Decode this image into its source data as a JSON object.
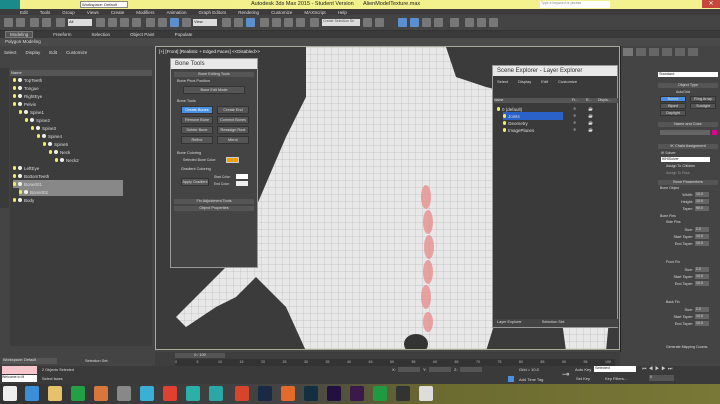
{
  "title": {
    "workspace": "Workspace: Default",
    "app": "Autodesk 3ds Max  2015  - Student Version",
    "file": "AlienModelTexture.max",
    "search_placeholder": "Type a keyword or phrase"
  },
  "menu": [
    "Edit",
    "Tools",
    "Group",
    "Views",
    "Create",
    "Modifiers",
    "Animation",
    "Graph Editors",
    "Rendering",
    "Customize",
    "MAXScript",
    "Help"
  ],
  "toolbar": {
    "filter": "All",
    "coord": "View",
    "selection_set": "Create Selection Se"
  },
  "ribbon": {
    "tabs": [
      "Modeling",
      "Freeform",
      "Selection",
      "Object Paint",
      "Populate"
    ],
    "sub": "Polygon Modeling"
  },
  "explorer": {
    "menu": [
      "Select",
      "Display",
      "Edit",
      "Customize"
    ],
    "col": "Name",
    "items": [
      {
        "name": "TopTeeth",
        "d": 0
      },
      {
        "name": "Tongue",
        "d": 0
      },
      {
        "name": "RightEye",
        "d": 0
      },
      {
        "name": "Pelvis",
        "d": 0
      },
      {
        "name": "Spine1",
        "d": 1
      },
      {
        "name": "Spine2",
        "d": 2
      },
      {
        "name": "Spine3",
        "d": 3
      },
      {
        "name": "Spine4",
        "d": 4
      },
      {
        "name": "Spine5",
        "d": 5
      },
      {
        "name": "Neck",
        "d": 6
      },
      {
        "name": "Neck2",
        "d": 7
      },
      {
        "name": "LeftEye",
        "d": 0
      },
      {
        "name": "BottomTeeth",
        "d": 0
      },
      {
        "name": "Bone001",
        "d": 0
      },
      {
        "name": "Bone002",
        "d": 1
      },
      {
        "name": "Body",
        "d": 0
      }
    ]
  },
  "viewport": {
    "label": "[+] [Front] [Realistic + Edged Faces] <<Disabled>>"
  },
  "bone_tools": {
    "title": "Bone Tools",
    "editing": "Bone Editing Tools",
    "pivot": "Bone Pivot Position",
    "edit_mode": "Bone Edit Mode",
    "tools": "Bone Tools",
    "buttons": [
      "Create Bones",
      "Create End",
      "Remove Bone",
      "Connect Bones",
      "Delete Bone",
      "Reassign Root",
      "Refine",
      "Mirror"
    ],
    "coloring": "Bone Coloring",
    "sel_color": "Selected Bone Color:",
    "gradient": "Gradient Coloring",
    "apply": "Apply Gradient",
    "start": "Start Color:",
    "end": "End Color:",
    "fin": "Fin Adjustment Tools",
    "props": "Object Properties",
    "accent": "#f5a000"
  },
  "layer_explorer": {
    "title": "Scene Explorer - Layer Explorer",
    "menu": [
      "Select",
      "Display",
      "Edit",
      "Customize"
    ],
    "cols": [
      "Name",
      "Fr...",
      "R...",
      "Displa..."
    ],
    "items": [
      "0 (default)",
      "Joints",
      "Geometry",
      "ImagePlanes"
    ],
    "footer": "Layer Explorer",
    "footer2": "Selection Set:"
  },
  "command": {
    "dropdown": "Standard",
    "object_type": "Object Type",
    "autogrid": "AutoGrid",
    "types": [
      "Bones",
      "Ring Array",
      "Biped",
      "Sunlight",
      "Daylight"
    ],
    "name_color": "Name and Color",
    "ik": "IK Chain Assignment",
    "ik_solver": "IK Solver:",
    "ik_value": "IKHISolver",
    "assign_children": "Assign To Children",
    "assign_root": "Assign To Root",
    "bone_params": "Bone Parameters",
    "bone_object": "Bone Object",
    "width": [
      "Width:",
      "10.0"
    ],
    "height": [
      "Height:",
      "10.0"
    ],
    "taper": [
      "Taper:",
      "90.0"
    ],
    "bone_fins": "Bone Fins",
    "fins": [
      "Side Fins",
      "Front Fin",
      "Back Fin"
    ],
    "size": [
      "Size:",
      "2.0"
    ],
    "start_taper": [
      "Start Taper:",
      "10.0"
    ],
    "end_taper": [
      "End Taper:",
      "10.0"
    ],
    "mapping": "Generate Mapping Coords.",
    "swatch": "#e0008a"
  },
  "timeline": {
    "frame": "0 / 100",
    "ticks": [
      "0",
      "5",
      "10",
      "15",
      "20",
      "25",
      "30",
      "35",
      "40",
      "45",
      "50",
      "55",
      "60",
      "65",
      "70",
      "75",
      "80",
      "85",
      "90",
      "95",
      "100"
    ]
  },
  "status": {
    "workspace": "Workspace: Default",
    "selset": "Selection Set:",
    "selected": "2 Objects Selected",
    "prompt": "Select faces",
    "script": "Welcome to M",
    "x": "X:",
    "y": "Y:",
    "z": "Z:",
    "grid": "Grid = 10.0",
    "add_tag": "Add Time Tag",
    "auto_key": "Auto Key",
    "set_key": "Set Key",
    "sel": "Selected",
    "key_filters": "Key Filters...",
    "frame": "0"
  }
}
